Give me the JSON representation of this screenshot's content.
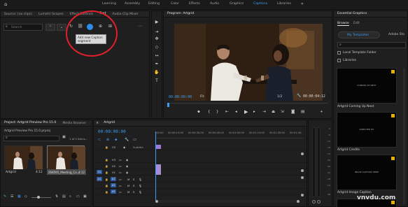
{
  "menubar": {
    "items": [
      "Learning",
      "Assembly",
      "Editing",
      "Color",
      "Effects",
      "Audio",
      "Graphics",
      "Captions",
      "Libraries"
    ],
    "active": "Captions",
    "accent": "#3d9df3"
  },
  "left_panel": {
    "tabs": [
      "Source: (no clips)",
      "Lumetri Scopes",
      "Effect Controls",
      "Text",
      "Audio Clip Mixer"
    ],
    "active_tab": "Text",
    "search_placeholder": "Search",
    "tooltip": [
      "Add new Caption",
      "segment"
    ],
    "highlight_color": "#e0202a"
  },
  "program_monitor": {
    "title": "Program: Artgrid",
    "timecode_left": "00:00:00:00",
    "fit_label": "Fit",
    "quality_label": "1/2",
    "timecode_right": "00:00:04:12"
  },
  "essential_graphics": {
    "title": "Essential Graphics",
    "tabs": [
      "Browse",
      "Edit"
    ],
    "active_tab": "Browse",
    "my_templates": "My Templates",
    "adobe_stock": "Adobe Sto",
    "local_folder": "Local Template Folder",
    "libraries": "Libraries",
    "cards": [
      {
        "name": "Artgrid Coming Up Next",
        "text": "COMING UP NEXT"
      },
      {
        "name": "Artgrid Credits",
        "text": "DIRECTED BY"
      },
      {
        "name": "Artgrid Image Caption",
        "text": "IMAGE CAPTION HERE"
      }
    ]
  },
  "project_panel": {
    "tabs": [
      "Project: Artgrid Preview Pro 15.0",
      "Media Browser"
    ],
    "active_tab": "Project: Artgrid Preview Pro 15.0",
    "file": "Artgrid Preview Pro 15.0.prproj",
    "count": "1 of 2 items...",
    "items": [
      {
        "name": "Artgrid",
        "duration": "4:12"
      },
      {
        "name": "268595_Meeting_Co...",
        "duration": "4:12"
      }
    ]
  },
  "timeline": {
    "tab": "Artgrid",
    "timecode": "00:00:00:00",
    "ruler": [
      ":00:00",
      "00:00:15:00",
      "00:00:30:00",
      "00:00:45:00",
      "00:01:00:00",
      "00:01:15:00",
      "00:01:30:00",
      "00:01:45:"
    ],
    "subtitle_label": "Subtitle",
    "video_tracks": [
      "V3",
      "V2",
      "V1"
    ],
    "audio_tracks": [
      "A1",
      "A2",
      "A3"
    ],
    "source_patch": [
      "V1",
      "A1"
    ],
    "track_labels": {
      "video": [
        "V3",
        "V2",
        "V1"
      ],
      "audio": [
        "A1",
        "A2",
        "A3"
      ]
    }
  },
  "meters": [
    "0",
    "-6",
    "-12",
    "-18",
    "-24",
    "-30",
    "-36",
    "-42",
    "-48",
    "-54",
    "dB"
  ],
  "watermark": "vnvdu.com"
}
